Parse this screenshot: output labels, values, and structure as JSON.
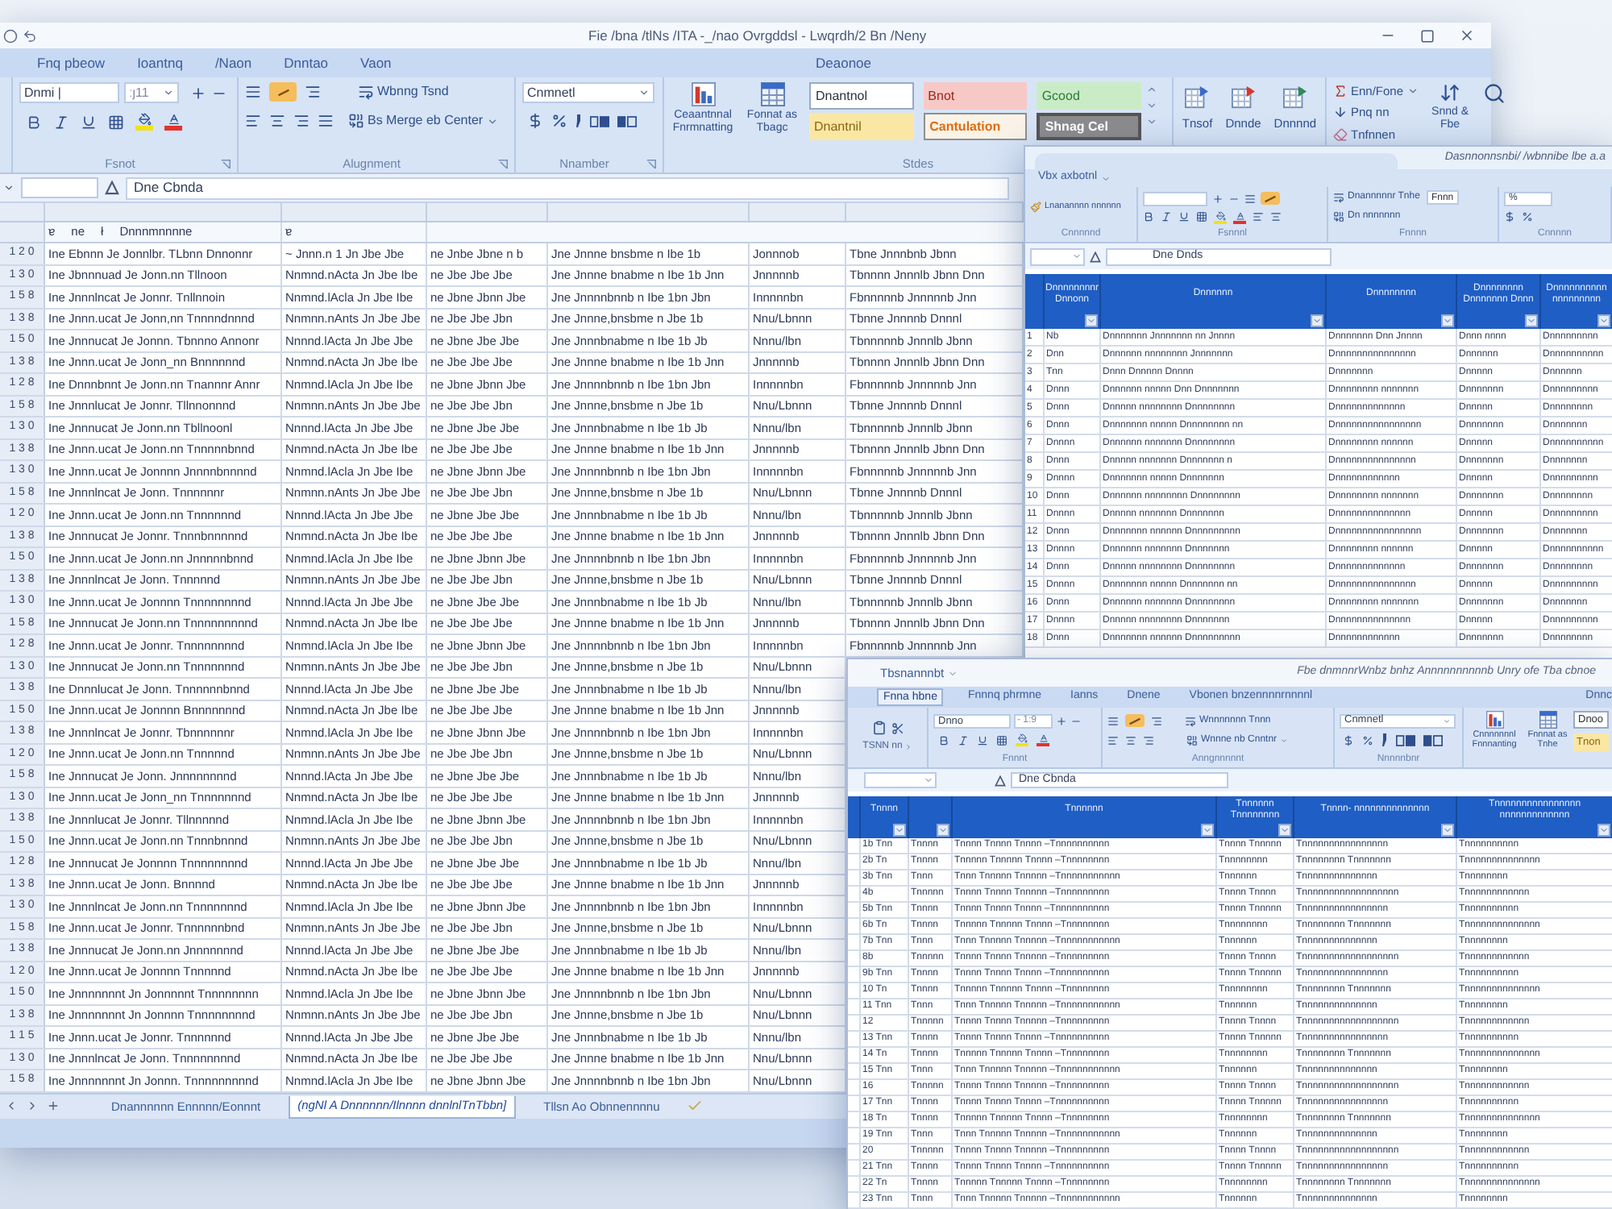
{
  "main_window": {
    "title": "Fie /bna /tlNs /ITA -_/nao Ovrgddsl - Lwqrdh/2 Bn /Neny",
    "tabs": [
      {
        "label": "Fnq pbeow",
        "selected": false
      },
      {
        "label": "Ioantnq",
        "selected": false
      },
      {
        "label": "/Naon",
        "selected": false
      },
      {
        "label": "Dnntao",
        "selected": false
      },
      {
        "label": "Vaon",
        "selected": false
      }
    ],
    "context_tab": "Deaonoe",
    "font": {
      "name": "Dnmi |",
      "size": "ːȷ11",
      "label": "Fsnot"
    },
    "alignment": {
      "wrap": "Wbnng Tsnd",
      "merge": "Bs Merge eb Center",
      "label": "Alugnment"
    },
    "number": {
      "format": "Cnmnetl",
      "label": "Nnamber"
    },
    "styles": {
      "conditional": "Ceaantnnal Fnrmnatting",
      "table": "Fonnat as Tbagc",
      "label": "Stdes",
      "gallery": [
        {
          "label": "Dnantnol",
          "kind": "normal"
        },
        {
          "label": "Bnot",
          "kind": "bad"
        },
        {
          "label": "Gcood",
          "kind": "good"
        },
        {
          "label": "Dnantnil",
          "kind": "neutral"
        },
        {
          "label": "Cantulation",
          "kind": "calculation"
        },
        {
          "label": "Shnag Cel",
          "kind": "check"
        }
      ]
    },
    "cells": [
      "Tnsof",
      "Dnnde",
      "Dnnnnd"
    ],
    "editing": {
      "sum": "Enn/Fone",
      "fill": "Pnq nn",
      "clear": "Tnfnnen",
      "sort": "Snnd & Fbe"
    },
    "formula": "Dne Cbnda",
    "header": {
      "column_2": [
        "ɐ",
        "ne",
        "ł",
        "Dnnnmnnnne"
      ],
      "column_3": [
        "ɐ"
      ]
    },
    "rows": [
      [
        "1 2 0",
        "Ine Ebnnn Je Jonnlbr.  TLbnn Dnnonnr",
        "~ Jnnn.n 1 Jn Jbe Jbe",
        "ne Jnbe Jbne n b",
        "Jne Jnnne bnsbme n Ibe 1b",
        "Jonnnob",
        "Tbne Jnnnbnb Jbnn"
      ],
      [
        "1 3 0",
        "Ine Jbnnnuad Je Jonn.nn  Tllnoon",
        "Nnmnd.nActa Jn Jbe Ibe",
        "ne Jbe Jbe Jbe",
        "Jne Jnnne bnabme n Ibe 1b Jnn",
        "Jnnnnnb",
        "Tbnnnn Jnnnlb Jbnn Dnn"
      ],
      [
        "1 5 8",
        "Ine Jnnnlncat Je Jonnr.  Tnllnnoin",
        "Nnmnd.lAcla Jn Jbe Ibe",
        "ne Jbne Jbnn Jbe",
        "Jne Jnnnnbnnb n Ibe 1bn Jbn",
        "Innnnnbn",
        "Fbnnnnnb Jnnnnnb Jnn"
      ],
      [
        "1 3 8",
        "Ine Jnnn.ucat Je Jonn,nn  Tnnnndnnnd",
        "Nnmnn.nAnts Jn Jbe Jbe",
        "ne Jbe Jbe Jbn",
        "Jne Jnnne,bnsbme n Jbe 1b",
        "Nnu/Lbnnn",
        "Tbnne Jnnnnb Dnnnl"
      ],
      [
        "1 5 0",
        "Ine Jnnnucat Je Jonnn.  Tbnnno Annonr",
        "Nnnnd.lActa Jn Jbe Jbe",
        "ne Jbne Jbe Jbe",
        "Jne Jnnnbnabme n Ibe 1b Jb",
        "Nnnu/lbn",
        "Tbnnnnnb Jnnnlb Jbnn"
      ],
      [
        "1 3 8",
        "Ine Jnnn.ucat Je Jonn_nn  Bnnnnnnd",
        "Nnmnd.nActa Jn Jbe Ibe",
        "ne Jbe Jbe Jbe",
        "Jne Jnnne bnabme n Ibe 1b Jnn",
        "Jnnnnnb",
        "Tbnnnn Jnnnlb Jbnn Dnn"
      ],
      [
        "1 2 8",
        "Ine Dnnnbnnt Je Jonn.nn  Tnannnr Annr",
        "Nnmnd.lAcla Jn Jbe Ibe",
        "ne Jbne Jbnn Jbe",
        "Jne Jnnnnbnnb n Ibe 1bn Jbn",
        "Innnnnbn",
        "Fbnnnnnb Jnnnnnb Jnn"
      ],
      [
        "1 5 8",
        "Ine Jnnnlucat Je Jonnr.  Tllnnonnnd",
        "Nnmnn.nAnts Jn Jbe Jbe",
        "ne Jbe Jbe Jbn",
        "Jne Jnnne,bnsbme n Jbe 1b",
        "Nnu/Lbnnn",
        "Tbnne Jnnnnb Dnnnl"
      ],
      [
        "1 3 0",
        "Ine Jnnnucat Je Jonn.nn  Tbllnoonl",
        "Nnnnd.lActa Jn Jbe Jbe",
        "ne Jbne Jbe Jbe",
        "Jne Jnnnbnabme n Ibe 1b Jb",
        "Nnnu/lbn",
        "Tbnnnnnb Jnnnlb Jbnn"
      ],
      [
        "1 3 8",
        "Ine Jnnn.ucat Je Jonn.nn  Tnnnnnbnnd",
        "Nnmnd.nActa Jn Jbe Ibe",
        "ne Jbe Jbe Jbe",
        "Jne Jnnne bnabme n Ibe 1b Jnn",
        "Jnnnnnb",
        "Tbnnnn Jnnnlb Jbnn Dnn"
      ],
      [
        "1 3 0",
        "Ine Jnnn.ucat Je Jonnnn  Jnnnnbnnnnd",
        "Nnmnd.lAcla Jn Jbe Ibe",
        "ne Jbne Jbnn Jbe",
        "Jne Jnnnnbnnb n Ibe 1bn Jbn",
        "Innnnnbn",
        "Fbnnnnnb Jnnnnnb Jnn"
      ],
      [
        "1 5 8",
        "Ine Jnnnlncat Je Jonn.  Tnnnnnnr",
        "Nnmnn.nAnts Jn Jbe Jbe",
        "ne Jbe Jbe Jbn",
        "Jne Jnnne,bnsbme n Jbe 1b",
        "Nnu/Lbnnn",
        "Tbnne Jnnnnb Dnnnl"
      ],
      [
        "1 2 0",
        "Ine Jnnn.ucat Je Jonn.nn  Tnnnnnnd",
        "Nnnnd.lActa Jn Jbe Jbe",
        "ne Jbne Jbe Jbe",
        "Jne Jnnnbnabme n Ibe 1b Jb",
        "Nnnu/lbn",
        "Tbnnnnnb Jnnnlb Jbnn"
      ],
      [
        "1 3 8",
        "Ine Jnnnucat Je Jonnr.  Tnnnbnnnnnd",
        "Nnmnd.nActa Jn Jbe Ibe",
        "ne Jbe Jbe Jbe",
        "Jne Jnnne bnabme n Ibe 1b Jnn",
        "Jnnnnnb",
        "Tbnnnn Jnnnlb Jbnn Dnn"
      ],
      [
        "1 5 0",
        "Ine Jnnn.ucat Je Jonn.nn  Jnnnnnbnnd",
        "Nnmnd.lAcla Jn Jbe Ibe",
        "ne Jbne Jbnn Jbe",
        "Jne Jnnnnbnnb n Ibe 1bn Jbn",
        "Innnnnbn",
        "Fbnnnnnb Jnnnnnb Jnn"
      ],
      [
        "1 3 8",
        "Ine Jnnnlncat Je Jonn.  Tnnnnnd",
        "Nnmnn.nAnts Jn Jbe Jbe",
        "ne Jbe Jbe Jbn",
        "Jne Jnnne,bnsbme n Jbe 1b",
        "Nnu/Lbnnn",
        "Tbnne Jnnnnb Dnnnl"
      ],
      [
        "1 3 0",
        "Ine Jnnn.ucat Je Jonnnn  Tnnnnnnnnd",
        "Nnnnd.lActa Jn Jbe Jbe",
        "ne Jbne Jbe Jbe",
        "Jne Jnnnbnabme n Ibe 1b Jb",
        "Nnnu/lbn",
        "Tbnnnnnb Jnnnlb Jbnn"
      ],
      [
        "1 5 8",
        "Ine Jnnnucat Je Jonn.nn  Tnnnnnnnnnd",
        "Nnmnd.nActa Jn Jbe Ibe",
        "ne Jbe Jbe Jbe",
        "Jne Jnnne bnabme n Ibe 1b Jnn",
        "Jnnnnnb",
        "Tbnnnn Jnnnlb Jbnn Dnn"
      ],
      [
        "1 2 8",
        "Ine Jnnn.ucat Je Jonnr.  Tnnnnnnnnd",
        "Nnmnd.lAcla Jn Jbe Ibe",
        "ne Jbne Jbnn Jbe",
        "Jne Jnnnnbnnb n Ibe 1bn Jbn",
        "Innnnnbn",
        "Fbnnnnnb Jnnnnnb Jnn"
      ],
      [
        "1 3 0",
        "Ine Jnnnucat Je Jonn.nn  Tnnnnnnnd",
        "Nnmnn.nAnts Jn Jbe Jbe",
        "ne Jbe Jbe Jbn",
        "Jne Jnnne,bnsbme n Jbe 1b",
        "Nnu/Lbnnn"
      ],
      [
        "1 3 8",
        "Ine Dnnnlucat Je Jonn.  Tnnnnnnbnnd",
        "Nnnnd.lActa Jn Jbe Jbe",
        "ne Jbne Jbe Jbe",
        "Jne Jnnnbnabme n Ibe 1b Jb",
        "Nnnu/lbn"
      ],
      [
        "1 5 0",
        "Ine Jnnn.ucat Je Jonnnn  Bnnnnnnnd",
        "Nnmnd.nActa Jn Jbe Ibe",
        "ne Jbe Jbe Jbe",
        "Jne Jnnne bnabme n Ibe 1b Jnn",
        "Jnnnnnb"
      ],
      [
        "1 3 8",
        "Ine Jnnnlncat Je Jonnr.  Tbnnnnnnr",
        "Nnmnd.lAcla Jn Jbe Ibe",
        "ne Jbne Jbnn Jbe",
        "Jne Jnnnnbnnb n Ibe 1bn Jbn",
        "Innnnnbn"
      ],
      [
        "1 2 0",
        "Ine Jnnn.ucat Je Jonn.nn  Tnnnnnd",
        "Nnmnn.nAnts Jn Jbe Jbe",
        "ne Jbe Jbe Jbn",
        "Jne Jnnne,bnsbme n Jbe 1b",
        "Nnu/Lbnnn"
      ],
      [
        "1 5 8",
        "Ine Jnnnucat Je Jonn.  Jnnnnnnnnd",
        "Nnnnd.lActa Jn Jbe Jbe",
        "ne Jbne Jbe Jbe",
        "Jne Jnnnbnabme n Ibe 1b Jb",
        "Nnnu/lbn"
      ],
      [
        "1 3 0",
        "Ine Jnnn.ucat Je Jonn_nn  Tnnnnnnnd",
        "Nnmnd.nActa Jn Jbe Ibe",
        "ne Jbe Jbe Jbe",
        "Jne Jnnne bnabme n Ibe 1b Jnn",
        "Jnnnnnb"
      ],
      [
        "1 3 8",
        "Ine Jnnnlucat Je Jonnr.  Tllnnnnnd",
        "Nnmnd.lAcla Jn Jbe Ibe",
        "ne Jbne Jbnn Jbe",
        "Jne Jnnnnbnnb n Ibe 1bn Jbn",
        "Innnnnbn"
      ],
      [
        "1 5 0",
        "Ine Jnnn.ucat Je Jonn.nn  Tnnnbnnnd",
        "Nnmnn.nAnts Jn Jbe Jbe",
        "ne Jbe Jbe Jbn",
        "Jne Jnnne,bnsbme n Jbe 1b",
        "Nnu/Lbnnn"
      ],
      [
        "1 2 8",
        "Ine Jnnnucat Je Jonnnn  Tnnnnnnnnd",
        "Nnnnd.lActa Jn Jbe Jbe",
        "ne Jbne Jbe Jbe",
        "Jne Jnnnbnabme n Ibe 1b Jb",
        "Nnnu/lbn"
      ],
      [
        "1 3 8",
        "Ine Jnnn.ucat Je Jonn.  Bnnnnd",
        "Nnmnd.nActa Jn Jbe Ibe",
        "ne Jbe Jbe Jbe",
        "Jne Jnnne bnabme n Ibe 1b Jnn",
        "Jnnnnnb"
      ],
      [
        "1 3 0",
        "Ine Jnnnlncat Je Jonn.nn  Tnnnnnnnd",
        "Nnmnd.lAcla Jn Jbe Ibe",
        "ne Jbne Jbnn Jbe",
        "Jne Jnnnnbnnb n Ibe 1bn Jbn",
        "Innnnnbn"
      ],
      [
        "1 5 8",
        "Ine Jnnn.ucat Je Jonnr.  Tnnnnnnbnd",
        "Nnmnn.nAnts Jn Jbe Jbe",
        "ne Jbe Jbe Jbn",
        "Jne Jnnne,bnsbme n Jbe 1b",
        "Nnu/Lbnnn"
      ],
      [
        "1 3 8",
        "Ine Jnnnucat Je Jonn.nn  Jnnnnnnnd",
        "Nnnnd.lActa Jn Jbe Jbe",
        "ne Jbne Jbe Jbe",
        "Jne Jnnnbnabme n Ibe 1b Jb",
        "Nnnu/lbn"
      ],
      [
        "1 2 0",
        "Ine Jnnn.ucat Je Jonnnn  Tnnnnnd",
        "Nnmnd.nActa Jn Jbe Ibe",
        "ne Jbe Jbe Jbe",
        "Jne Jnnne bnabme n Ibe 1b Jnn",
        "Jnnnnnb"
      ],
      [
        "1 5 0",
        "Ine Jnnnnnnnt Jn Jonnnnnt  Tnnnnnnnn",
        "Nnmnd.lAcla Jn Jbe Ibe",
        "ne Jbne Jbnn Jbe",
        "Jne Jnnnnbnnb n Ibe 1bn Jbn",
        "Nnu/Lbnnn"
      ],
      [
        "1 3 8",
        "Ine Jnnnnnnnt Jn Jonnnn  Tnnnnnnnnd",
        "Nnmnn.nAnts Jn Jbe Jbe",
        "ne Jbe Jbe Jbn",
        "Jne Jnnne,bnsbme n Jbe 1b",
        "Nnu/Lbnnn"
      ],
      [
        "1 1 5",
        "Ine Jnnn.ucat Je Jonnr.  Tnnnnnnd",
        "Nnnnd.lActa Jn Jbe Jbe",
        "ne Jbne Jbe Jbe",
        "Jne Jnnnbnabme n Ibe 1b Jb",
        "Nnnu/lbn"
      ],
      [
        "1 3 0",
        "Ine Jnnnlncat Je Jonn.  Tnnnnnnnnd",
        "Nnmnd.nActa Jn Jbe Ibe",
        "ne Jbe Jbe Jbe",
        "Jne Jnnne bnabme n Ibe 1b Jnn",
        "Nnu/Lbnnn"
      ],
      [
        "1 5 8",
        "Ine Jnnnnnnnt Jn Jonnn.  Tnnnnnnnnnd",
        "Nnmnd.lAcla Jn Jbe Ibe",
        "ne Jbne Jbnn Jbe",
        "Jne Jnnnnbnnb n Ibe 1bn Jbn",
        "Nnu/Lbnnn"
      ]
    ],
    "sheet_tabs": [
      {
        "label": "Dnannnnnn Ennnnn/Eonnnt",
        "selected": false
      },
      {
        "label": "(ngNl A Dnnnnnn/Ilnnnn dnnlnlTnTbbn]",
        "selected": true
      },
      {
        "label": "Tllsn Ao Obnnennnnu",
        "selected": false
      }
    ]
  },
  "window_2": {
    "title": "Dasnnonnsnbi/ /wbnnibe lbe a.a",
    "tab": "Vbx axbotnl",
    "clipboard": "Lnanannnn nnnnnn",
    "wrap": "Dnannnnnr Tnhe",
    "merge": "Dn nnnnnnn",
    "style_cell": "Fnnn",
    "number_field": "%",
    "groups": [
      "Cnnnnnd",
      "Fsnnnl",
      "Fnnnn",
      "Cnnnnn"
    ],
    "formula": "Dne Dnds",
    "columns": [
      "Dnnnnnnnnr Dnnonn",
      "Dnnnnnn",
      "Dnnnnnnnn",
      "Dnnnnnnnn Dnnnnnnn Dnnn",
      "Dnnnnnnnnnn nnnnnnnnn"
    ],
    "rows": [
      {
        "number": "1",
        "cells": [
          "Nb",
          "Dnnnnnnn Jnnnnnnn nn Jnnnn",
          "Dnnnnnnn Dnn Jnnnn",
          "Dnnn nnnn",
          "Dnnnnnnnnn"
        ]
      },
      {
        "number": "2",
        "cells": [
          "Dnn",
          "Dnnnnnn nnnnnnnn Jnnnnnnn",
          "Dnnnnnnnnnnnnnnn",
          "Dnnnnnn",
          "Dnnnnnnnnnn"
        ]
      },
      {
        "number": "3",
        "cells": [
          "Tnn",
          "Dnnn  Dnnnnn  Dnnnn",
          "Dnnnnnnn",
          "Dnnnnn",
          "Dnnnnnn"
        ]
      },
      {
        "number": "4",
        "cells": [
          "Dnnn",
          "Dnnnnnn nnnnn Dnn Dnnnnnnn",
          "Dnnnnnnnn nnnnnnn",
          "Dnnnnnnn",
          "Dnnnnnnnnn"
        ]
      },
      {
        "number": "5",
        "cells": [
          "Dnnn",
          "Dnnnnn nnnnnnnn Dnnnnnnnn",
          "Dnnnnnnnnnnnnn",
          "Dnnnnn",
          "Dnnnnnnnn"
        ]
      },
      {
        "number": "6",
        "cells": [
          "Dnnn",
          "Dnnnnnnn nnnnn Dnnnnnnnn nn",
          "Dnnnnnnnnnnnnnnnn",
          "Dnnnnnnn",
          "Dnnnnnnn"
        ]
      },
      {
        "number": "7",
        "cells": [
          "Dnnnn",
          "Dnnnnnn nnnnnnn Dnnnnnnnn",
          "Dnnnnnnnn nnnnnn",
          "Dnnnnn",
          "Dnnnnnnnnnn"
        ]
      },
      {
        "number": "8",
        "cells": [
          "Dnnn",
          "Dnnnnn nnnnnnn Dnnnnnnn n",
          "Dnnnnnnnnnnnnnnn",
          "Dnnnnnnn",
          "Dnnnnnnn"
        ]
      },
      {
        "number": "9",
        "cells": [
          "Dnnnn",
          "Dnnnnnnn nnnnn Dnnnnnnn",
          "Dnnnnnnnnnnnn",
          "Dnnnnn",
          "Dnnnnnnnnn"
        ]
      },
      {
        "number": "10",
        "cells": [
          "Dnnn",
          "Dnnnnnn nnnnnnnn Dnnnnnnnn",
          "Dnnnnnnnn nnnnnnn",
          "Dnnnnnnn",
          "Dnnnnnnnn"
        ]
      },
      {
        "number": "11",
        "cells": [
          "Dnnnn",
          "Dnnnnn nnnnnnn Dnnnnnnn",
          "Dnnnnnnnnnnnnnn",
          "Dnnnnn",
          "Dnnnnnnnnn"
        ]
      },
      {
        "number": "12",
        "cells": [
          "Dnnn",
          "Dnnnnnnn nnnnnn Dnnnnnnnnn",
          "Dnnnnnnnnnnnnnnnn",
          "Dnnnnnnn",
          "Dnnnnnnn"
        ]
      },
      {
        "number": "13",
        "cells": [
          "Dnnnn",
          "Dnnnnnn nnnnnnn Dnnnnnnn",
          "Dnnnnnnnn nnnnnn",
          "Dnnnnn",
          "Dnnnnnnnnnn"
        ]
      },
      {
        "number": "14",
        "cells": [
          "Dnnn",
          "Dnnnnn nnnnnnnn Dnnnnnnnn",
          "Dnnnnnnnnnnnnn",
          "Dnnnnnnn",
          "Dnnnnnnnn"
        ]
      },
      {
        "number": "15",
        "cells": [
          "Dnnnn",
          "Dnnnnnnn nnnnn Dnnnnnnn nn",
          "Dnnnnnnnnnnnnnnn",
          "Dnnnnn",
          "Dnnnnnnnnn"
        ]
      },
      {
        "number": "16",
        "cells": [
          "Dnnn",
          "Dnnnnnn nnnnnnn Dnnnnnnnn",
          "Dnnnnnnnn nnnnnnn",
          "Dnnnnnnn",
          "Dnnnnnnn"
        ]
      },
      {
        "number": "17",
        "cells": [
          "Dnnnn",
          "Dnnnnn nnnnnnnn Dnnnnnnn",
          "Dnnnnnnnnnnnnnn",
          "Dnnnnn",
          "Dnnnnnnnnn"
        ]
      },
      {
        "number": "18",
        "cells": [
          "Dnnn",
          "Dnnnnnnn nnnnnn Dnnnnnnnnn",
          "Dnnnnnnnnnnnn",
          "Dnnnnnnn",
          "Dnnnnnnnn"
        ]
      }
    ]
  },
  "window_3": {
    "title": "Tbsnannnbt",
    "title_right": "Fbe dnmnnrWnbz bnhz Annnnnnnnnnb Unry ofe Tba cbnoe",
    "tabs": [
      {
        "label": "Fnna hbne",
        "selected": true
      },
      {
        "label": "Fnnnq phrmne",
        "selected": false
      },
      {
        "label": "Ianns",
        "selected": false
      },
      {
        "label": "Dnene",
        "selected": false
      },
      {
        "label": "Vbonen bnzennnnrnnnnl",
        "selected": false
      }
    ],
    "context_tab": "Dnnc",
    "clipboard": "TSNN nn",
    "font": "Dnno",
    "size": "- 1:9",
    "wrap": "Wnnnnnnn Tnnn",
    "merge": "Wnnne nb Cnntnr",
    "number": "Cnmnetl",
    "conditional": "Cnnnnnnnl Fnnnanting",
    "table": "Fnnnat as Tnhe",
    "styles": [
      {
        "label": "Dnoo",
        "kind": "normal"
      },
      {
        "label": "Tnon",
        "kind": "neutral"
      }
    ],
    "groups": [
      "Fnnnt",
      "Anngnnnnnt",
      "Nnnnnbnr"
    ],
    "formula": "Dne Cbnda",
    "columns": [
      {
        "kind": "label",
        "label": "Tnnnn"
      },
      {
        "kind": "blank"
      },
      {
        "kind": "label",
        "label": "Tnnnnnn"
      },
      {
        "kind": "label",
        "label": "Tnnnnnn Tnnnnnnnn"
      },
      {
        "kind": "label",
        "label": "Tnnnn- nnnnnnnnnnnnnn"
      },
      {
        "kind": "label",
        "label": "Tnnnnnnnnnnnnnnnn nnnnnnnnnnnnn"
      }
    ],
    "rows": [
      [
        "1b Tnn",
        "Tnnnn",
        "Tnnnn Tnnnn Tnnnn –Tnnnnnnnnnn",
        "Tnnnn Tnnnnn",
        "Tnnnnnnnnnnnnnnnn",
        "Tnnnnnnnnnn"
      ],
      [
        "2b Tn",
        "Tnnnn",
        "Tnnnnn Tnnnnn Tnnnn –Tnnnnnnnn",
        "Tnnnnnnnn",
        "Tnnnnnnnn Tnnnnnnn",
        "Tnnnnnnnnnnnnnn"
      ],
      [
        "3b Tnn",
        "Tnnn",
        "Tnnn Tnnnnn Tnnnnn –Tnnnnnnnnnnn",
        "Tnnnnnn",
        "Tnnnnnnnnnnnnnn",
        "Tnnnnnnnn"
      ],
      [
        "4b",
        "Tnnnnn",
        "Tnnnn Tnnnn Tnnnnn –Tnnnnnnnnn",
        "Tnnnn Tnnnn",
        "Tnnnnnnnnnnnnnnnnnn",
        "Tnnnnnnnnnnnn"
      ],
      [
        "5b Tnn",
        "Tnnnn",
        "Tnnnn Tnnnn Tnnnn –Tnnnnnnnnnn",
        "Tnnnn Tnnnnn",
        "Tnnnnnnnnnnnnnnnn",
        "Tnnnnnnnnnn"
      ],
      [
        "6b Tn",
        "Tnnnn",
        "Tnnnnn Tnnnnn Tnnnn –Tnnnnnnnn",
        "Tnnnnnnnn",
        "Tnnnnnnnn Tnnnnnnn",
        "Tnnnnnnnnnnnnnn"
      ],
      [
        "7b Tnn",
        "Tnnn",
        "Tnnn Tnnnnn Tnnnnn –Tnnnnnnnnnnn",
        "Tnnnnnn",
        "Tnnnnnnnnnnnnnn",
        "Tnnnnnnnn"
      ],
      [
        "8b",
        "Tnnnnn",
        "Tnnnn Tnnnn Tnnnnn –Tnnnnnnnnn",
        "Tnnnn Tnnnn",
        "Tnnnnnnnnnnnnnnnnnn",
        "Tnnnnnnnnnnnn"
      ],
      [
        "9b Tnn",
        "Tnnnn",
        "Tnnnn Tnnnn Tnnnn –Tnnnnnnnnnn",
        "Tnnnn Tnnnnn",
        "Tnnnnnnnnnnnnnnnn",
        "Tnnnnnnnnnn"
      ],
      [
        "10 Tn",
        "Tnnnn",
        "Tnnnnn Tnnnnn Tnnnn –Tnnnnnnnn",
        "Tnnnnnnnn",
        "Tnnnnnnnn Tnnnnnnn",
        "Tnnnnnnnnnnnnnn"
      ],
      [
        "11 Tnn",
        "Tnnn",
        "Tnnn Tnnnnn Tnnnnn –Tnnnnnnnnnnn",
        "Tnnnnnn",
        "Tnnnnnnnnnnnnnn",
        "Tnnnnnnnn"
      ],
      [
        "12",
        "Tnnnnn",
        "Tnnnn Tnnnn Tnnnnn –Tnnnnnnnnn",
        "Tnnnn Tnnnn",
        "Tnnnnnnnnnnnnnnnnnn",
        "Tnnnnnnnnnnnn"
      ],
      [
        "13 Tnn",
        "Tnnnn",
        "Tnnnn Tnnnn Tnnnn –Tnnnnnnnnnn",
        "Tnnnn Tnnnnn",
        "Tnnnnnnnnnnnnnnnn",
        "Tnnnnnnnnnn"
      ],
      [
        "14 Tn",
        "Tnnnn",
        "Tnnnnn Tnnnnn Tnnnn –Tnnnnnnnn",
        "Tnnnnnnnn",
        "Tnnnnnnnn Tnnnnnnn",
        "Tnnnnnnnnnnnnnn"
      ],
      [
        "15 Tnn",
        "Tnnn",
        "Tnnn Tnnnnn Tnnnnn –Tnnnnnnnnnnn",
        "Tnnnnnn",
        "Tnnnnnnnnnnnnnn",
        "Tnnnnnnnn"
      ],
      [
        "16",
        "Tnnnnn",
        "Tnnnn Tnnnn Tnnnnn –Tnnnnnnnnn",
        "Tnnnn Tnnnn",
        "Tnnnnnnnnnnnnnnnnnn",
        "Tnnnnnnnnnnnn"
      ],
      [
        "17 Tnn",
        "Tnnnn",
        "Tnnnn Tnnnn Tnnnn –Tnnnnnnnnnn",
        "Tnnnn Tnnnnn",
        "Tnnnnnnnnnnnnnnnn",
        "Tnnnnnnnnnn"
      ],
      [
        "18 Tn",
        "Tnnnn",
        "Tnnnnn Tnnnnn Tnnnn –Tnnnnnnnn",
        "Tnnnnnnnn",
        "Tnnnnnnnn Tnnnnnnn",
        "Tnnnnnnnnnnnnnn"
      ],
      [
        "19 Tnn",
        "Tnnn",
        "Tnnn Tnnnnn Tnnnnn –Tnnnnnnnnnnn",
        "Tnnnnnn",
        "Tnnnnnnnnnnnnnn",
        "Tnnnnnnnn"
      ],
      [
        "20",
        "Tnnnnn",
        "Tnnnn Tnnnn Tnnnnn –Tnnnnnnnnn",
        "Tnnnn Tnnnn",
        "Tnnnnnnnnnnnnnnnnnn",
        "Tnnnnnnnnnnnn"
      ],
      [
        "21 Tnn",
        "Tnnnn",
        "Tnnnn Tnnnn Tnnnn –Tnnnnnnnnnn",
        "Tnnnn Tnnnnn",
        "Tnnnnnnnnnnnnnnnn",
        "Tnnnnnnnnnn"
      ],
      [
        "22 Tn",
        "Tnnnn",
        "Tnnnnn Tnnnnn Tnnnn –Tnnnnnnnn",
        "Tnnnnnnnn",
        "Tnnnnnnnn Tnnnnnnn",
        "Tnnnnnnnnnnnnnn"
      ],
      [
        "23 Tnn",
        "Tnnn",
        "Tnnn Tnnnnn Tnnnnn –Tnnnnnnnnnnn",
        "Tnnnnnn",
        "Tnnnnnnnnnnnnnn",
        "Tnnnnnnnn"
      ]
    ]
  }
}
